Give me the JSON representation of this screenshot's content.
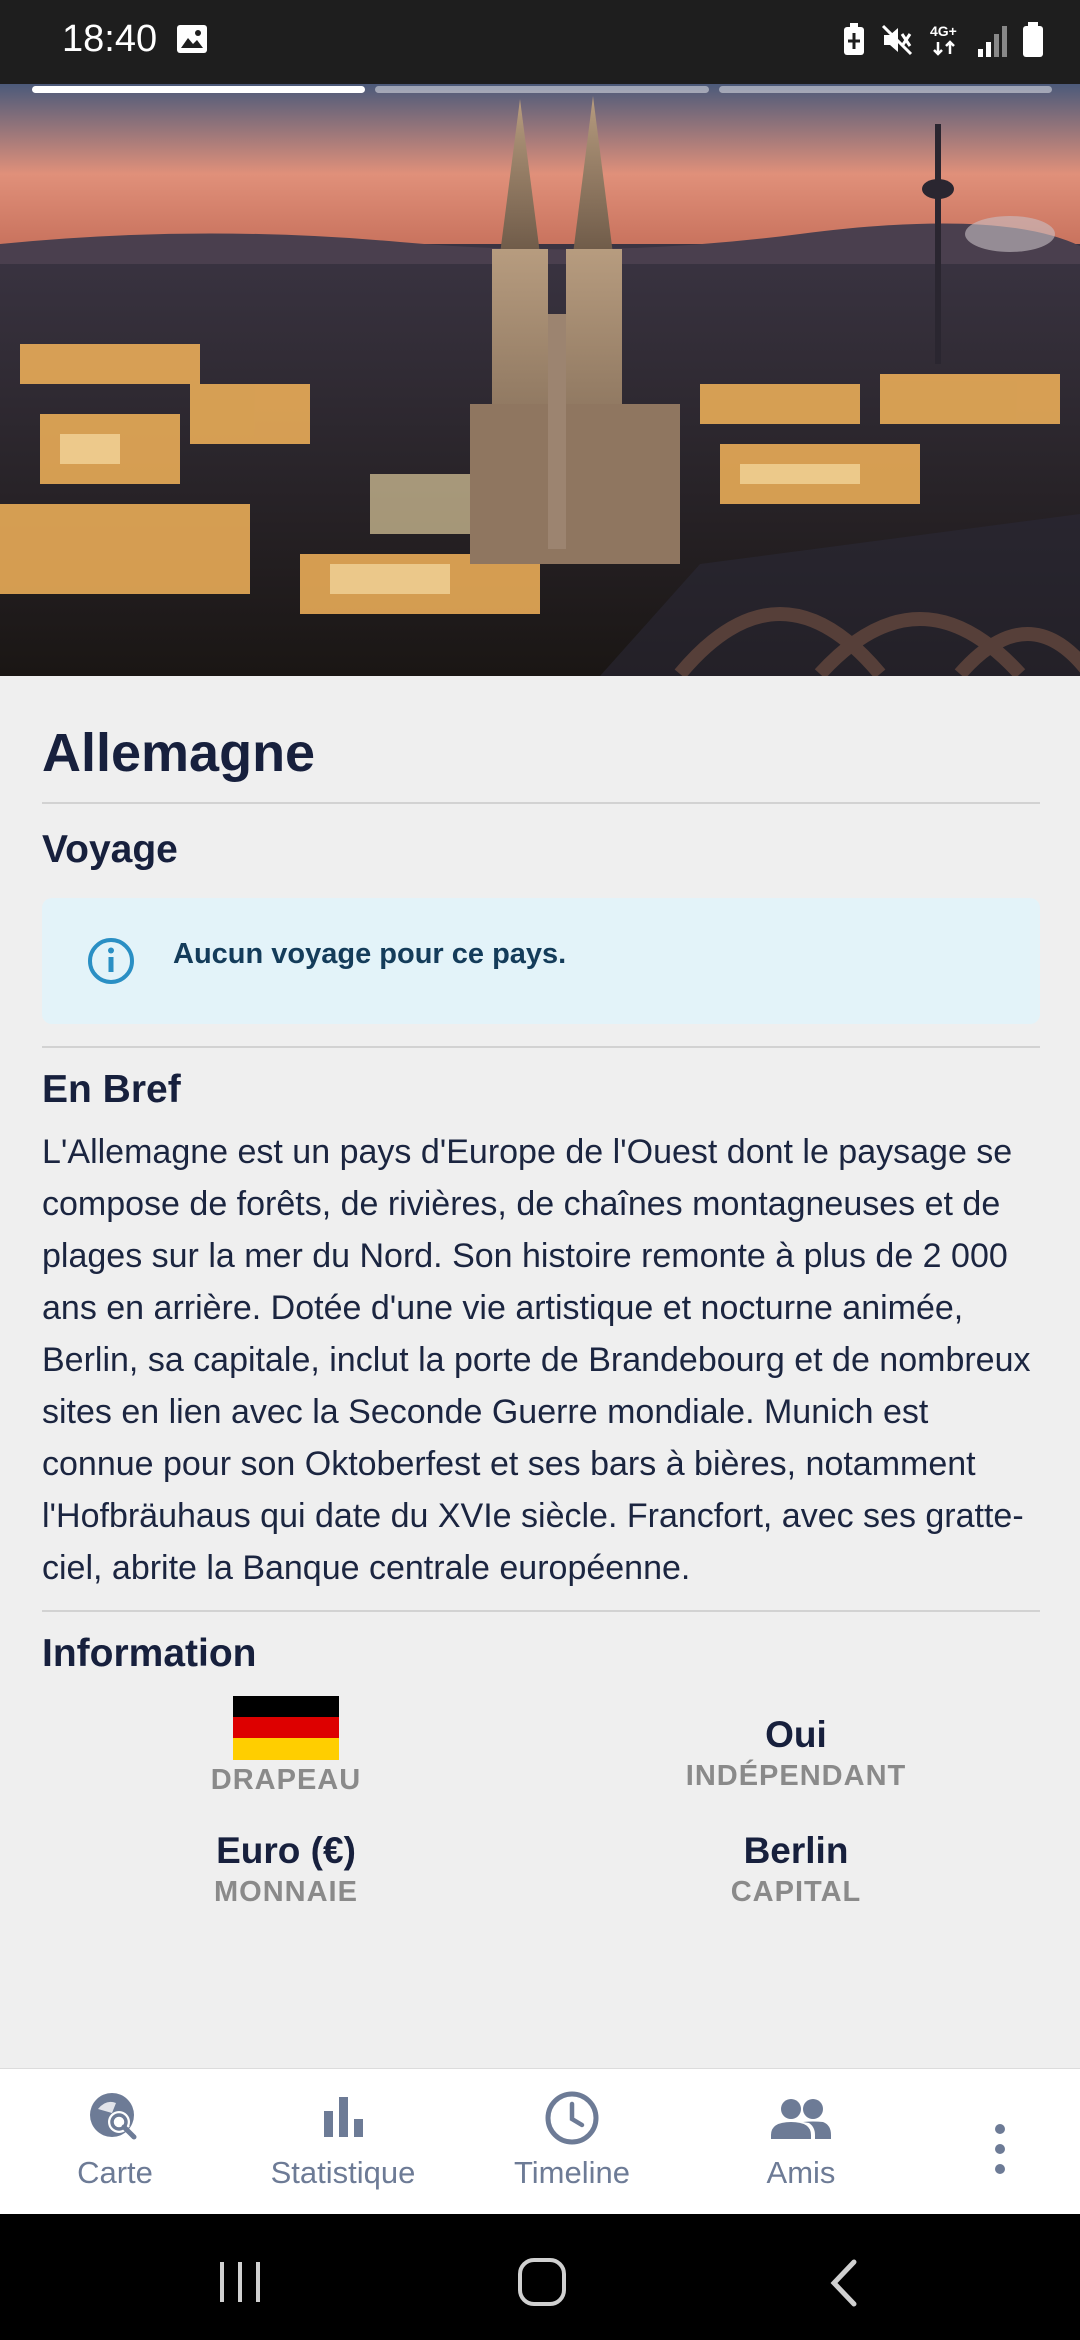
{
  "status_bar": {
    "time": "18:40",
    "network": "4G+",
    "icons": [
      "image-icon",
      "battery-saver-icon",
      "mute-icon",
      "network-4g-icon",
      "signal-icon",
      "battery-icon"
    ]
  },
  "hero": {
    "image_desc": "Cologne skyline at dusk",
    "progress_segments": 3,
    "active_segment": 1
  },
  "country": {
    "name": "Allemagne"
  },
  "voyage": {
    "title": "Voyage",
    "empty_message": "Aucun voyage pour ce pays."
  },
  "brief": {
    "title": "En Bref",
    "text": "L'Allemagne est un pays d'Europe de l'Ouest dont le paysage se compose de forêts, de rivières, de chaînes montagneuses et de plages sur la mer du Nord. Son histoire remonte à plus de 2 000 ans en arrière. Dotée d'une vie artistique et nocturne animée, Berlin, sa capitale, inclut la porte de Brandebourg et de nombreux sites en lien avec la Seconde Guerre mondiale. Munich est connue pour son Oktoberfest et ses bars à bières, notamment l'Hofbräuhaus qui date du XVIe siècle. Francfort, avec ses gratte-ciel, abrite la Banque centrale européenne."
  },
  "information": {
    "title": "Information",
    "flag_label": "DRAPEAU",
    "flag_colors": [
      "#000000",
      "#dd0000",
      "#ffce00"
    ],
    "independent_value": "Oui",
    "independent_label": "INDÉPENDANT",
    "currency_value": "Euro (€)",
    "currency_label": "MONNAIE",
    "capital_value": "Berlin",
    "capital_label": "CAPITAL"
  },
  "bottom_nav": {
    "items": [
      {
        "label": "Carte",
        "icon": "map-search-icon"
      },
      {
        "label": "Statistique",
        "icon": "bar-chart-icon"
      },
      {
        "label": "Timeline",
        "icon": "clock-icon"
      },
      {
        "label": "Amis",
        "icon": "people-icon"
      }
    ],
    "more_icon": "more-vert-icon"
  },
  "colors": {
    "primary_text": "#17203d",
    "nav_icon": "#6d7b96",
    "info_bg": "#e3f3f9",
    "info_icon": "#2a8fc4"
  }
}
